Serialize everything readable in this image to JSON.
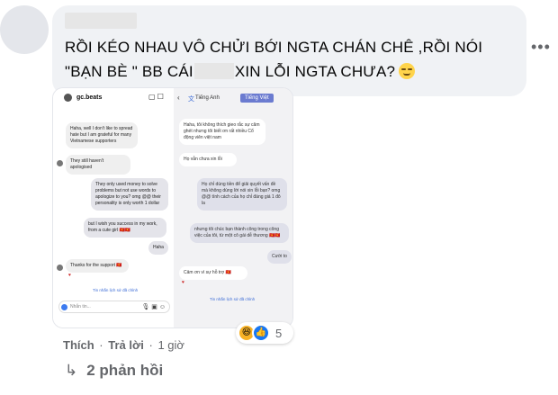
{
  "comment": {
    "text_part1": "RỒI KÉO NHAU VÔ CHỬI BỚI NGTA CHÁN CHÊ ,RỒI NÓI \"BẠN BÈ \" BB CÁI",
    "text_part2": "XIN LỖI NGTA CHƯA?",
    "more_label": "•••"
  },
  "attachment": {
    "instagram": {
      "username": "gc.beats",
      "header_icons": "▢ ☐",
      "messages": [
        "Haha, well I don't like to spread hate but I am grateful for many Vietnamese supporters",
        "They still haven't apologised",
        "They only used money to solve problems but not use words to apologize to you? omg @@ their personality is only worth 1 dollar",
        "but I wish you success in my work, from a cute girl 🇻🇳🇻🇳",
        "Haha",
        "Thanks for the support 🇻🇳",
        "♥"
      ],
      "link_label": "Tin nhắn lịch sử đã chỉnh",
      "input_placeholder": "Nhắn tin...",
      "input_tools": "🎙 ▣ ☺"
    },
    "translate": {
      "back": "‹",
      "icon": "文",
      "source_lang": "Tiếng Anh",
      "target_lang": "Tiếng Việt",
      "messages": [
        "Haha, tôi không thích gieo rắc sự căm ghét nhưng tôi biết ơn rất nhiều Cổ động viên việt nam",
        "Họ vẫn chưa xin lỗi",
        "Họ chỉ dùng tiền để giải quyết vấn đề mà không dùng lời nói xin lỗi bạn? omg @@ tính cách của họ chỉ đáng giá 1 đô la",
        "nhưng tôi chúc bạn thành công trong công việc của tôi, từ một cô gái dễ thương 🇻🇳🇻🇳",
        "Cười to",
        "Cảm ơn vì sự hỗ trợ 🇻🇳",
        "♥"
      ],
      "link_label": "Tin nhắn lịch sử đã chỉnh"
    }
  },
  "actions": {
    "like": "Thích",
    "reply": "Trả lời",
    "time": "1 giờ",
    "separator": "·"
  },
  "reactions": {
    "haha_icon": "😆",
    "like_icon": "👍",
    "count": "5"
  },
  "replies": {
    "arrow": "↳",
    "label": "2 phản hồi"
  },
  "colors": {
    "bubble_bg": "#f0f2f5",
    "secondary_text": "#65676b",
    "like_blue": "#1877f2"
  }
}
